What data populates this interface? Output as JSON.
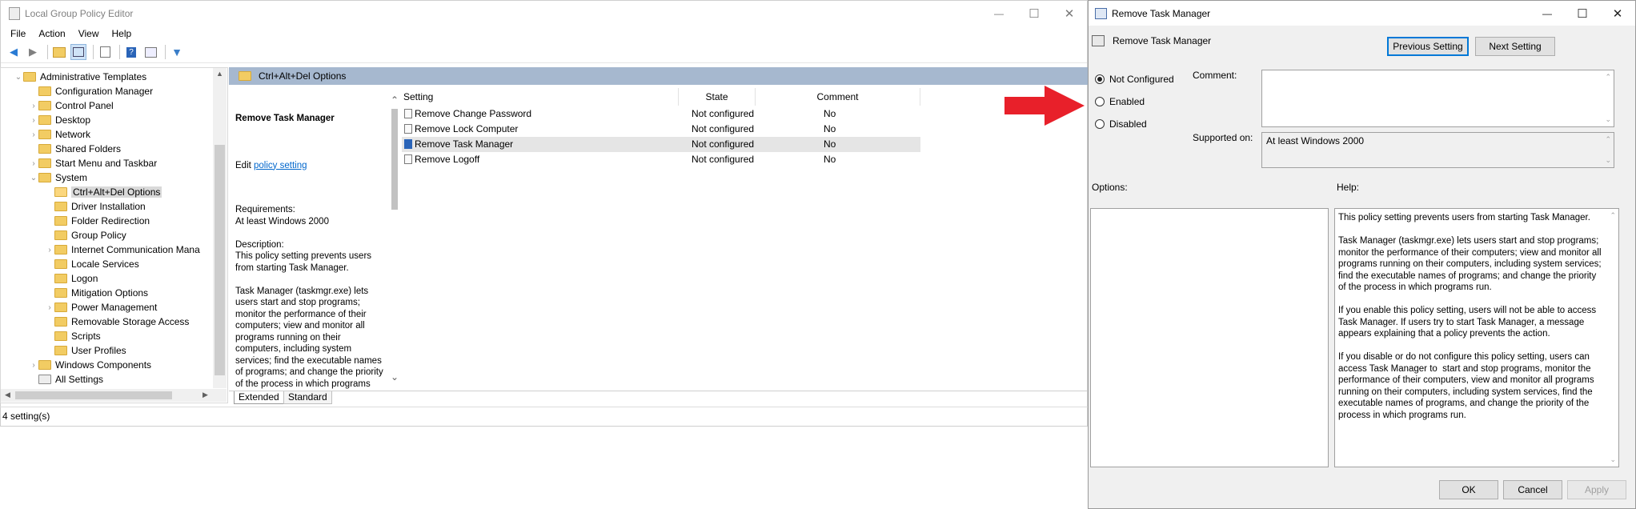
{
  "main_window": {
    "title": "Local Group Policy Editor",
    "controls": {
      "minimize": "—",
      "maximize": "☐",
      "close": "✕"
    },
    "menu": [
      "File",
      "Action",
      "View",
      "Help"
    ],
    "tree": [
      {
        "label": "Administrative Templates",
        "level": 0,
        "expanded": true
      },
      {
        "label": "Configuration Manager",
        "level": 1
      },
      {
        "label": "Control Panel",
        "level": 1,
        "expandable": true
      },
      {
        "label": "Desktop",
        "level": 1,
        "expandable": true
      },
      {
        "label": "Network",
        "level": 1,
        "expandable": true
      },
      {
        "label": "Shared Folders",
        "level": 1
      },
      {
        "label": "Start Menu and Taskbar",
        "level": 1,
        "expandable": true
      },
      {
        "label": "System",
        "level": 1,
        "expanded": true
      },
      {
        "label": "Ctrl+Alt+Del Options",
        "level": 2,
        "selected": true
      },
      {
        "label": "Driver Installation",
        "level": 2
      },
      {
        "label": "Folder Redirection",
        "level": 2
      },
      {
        "label": "Group Policy",
        "level": 2
      },
      {
        "label": "Internet Communication Mana",
        "level": 2,
        "expandable": true
      },
      {
        "label": "Locale Services",
        "level": 2
      },
      {
        "label": "Logon",
        "level": 2
      },
      {
        "label": "Mitigation Options",
        "level": 2
      },
      {
        "label": "Power Management",
        "level": 2,
        "expandable": true
      },
      {
        "label": "Removable Storage Access",
        "level": 2
      },
      {
        "label": "Scripts",
        "level": 2
      },
      {
        "label": "User Profiles",
        "level": 2
      },
      {
        "label": "Windows Components",
        "level": 1,
        "expandable": true
      },
      {
        "label": "All Settings",
        "level": 1,
        "special": true
      }
    ],
    "folder_header": "Ctrl+Alt+Del Options",
    "description": {
      "title": "Remove Task Manager",
      "edit_prefix": "Edit ",
      "edit_link": "policy setting",
      "body": "Requirements:\nAt least Windows 2000\n\nDescription:\nThis policy setting prevents users from starting Task Manager.\n\nTask Manager (taskmgr.exe) lets users start and stop programs; monitor the performance of their computers; view and monitor all programs running on their computers, including system services; find the executable names of programs; and change the priority of the process in which programs run.\n\nIf you enable this policy setting, users will not be able to access Task Manager. If users try to start"
    },
    "columns": {
      "setting": "Setting",
      "state": "State",
      "comment": "Comment"
    },
    "rows": [
      {
        "setting": "Remove Change Password",
        "state": "Not configured",
        "comment": "No"
      },
      {
        "setting": "Remove Lock Computer",
        "state": "Not configured",
        "comment": "No"
      },
      {
        "setting": "Remove Task Manager",
        "state": "Not configured",
        "comment": "No",
        "selected": true
      },
      {
        "setting": "Remove Logoff",
        "state": "Not configured",
        "comment": "No"
      }
    ],
    "tabs": [
      "Extended",
      "Standard"
    ],
    "status": "4 setting(s)"
  },
  "dialog": {
    "title": "Remove Task Manager",
    "setting_name": "Remove Task Manager",
    "previous_button": "Previous Setting",
    "next_button": "Next Setting",
    "options": [
      "Not Configured",
      "Enabled",
      "Disabled"
    ],
    "selected_option": "Not Configured",
    "comment_label": "Comment:",
    "supported_label": "Supported on:",
    "supported_value": "At least Windows 2000",
    "options_label": "Options:",
    "help_label": "Help:",
    "help_text": "This policy setting prevents users from starting Task Manager.\n\nTask Manager (taskmgr.exe) lets users start and stop programs; monitor the performance of their computers; view and monitor all programs running on their computers, including system services; find the executable names of programs; and change the priority of the process in which programs run.\n\nIf you enable this policy setting, users will not be able to access Task Manager. If users try to start Task Manager, a message appears explaining that a policy prevents the action.\n\nIf you disable or do not configure this policy setting, users can access Task Manager to  start and stop programs, monitor the performance of their computers, view and monitor all programs running on their computers, including system services, find the executable names of programs, and change the priority of the process in which programs run.",
    "ok_button": "OK",
    "cancel_button": "Cancel",
    "apply_button": "Apply"
  },
  "annotation": {
    "arrow_color": "#e8202a",
    "points_to": "Enabled"
  }
}
